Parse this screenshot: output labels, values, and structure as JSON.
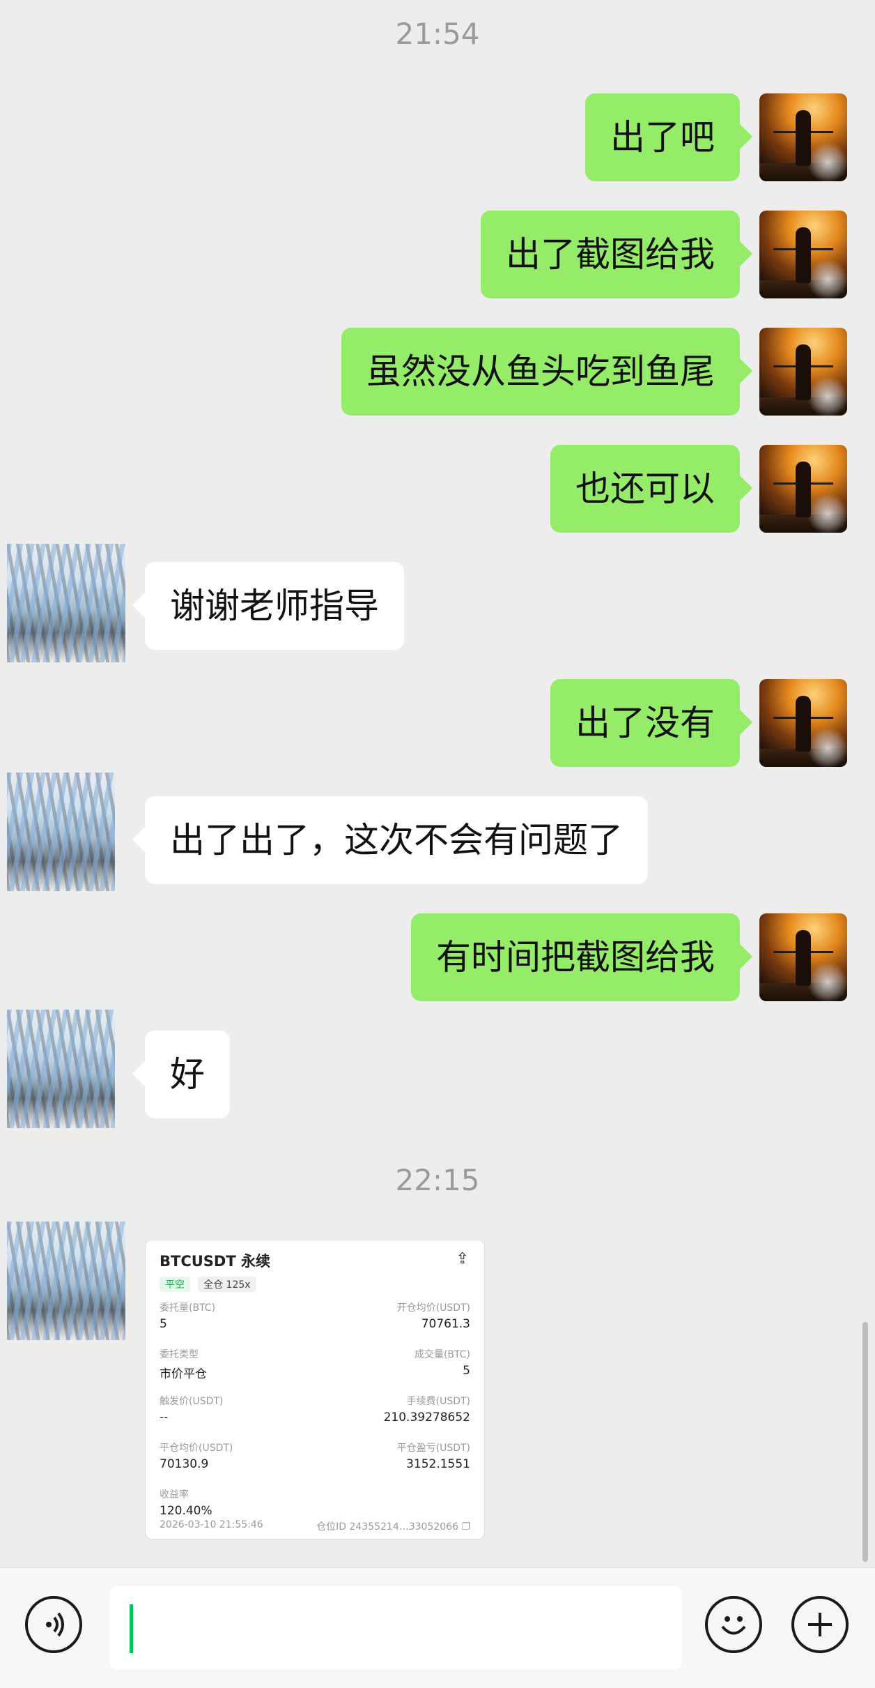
{
  "timestamps": [
    "21:54",
    "22:15"
  ],
  "messages": [
    {
      "from": "me",
      "text": "出了吧"
    },
    {
      "from": "me",
      "text": "出了截图给我"
    },
    {
      "from": "me",
      "text": "虽然没从鱼头吃到鱼尾"
    },
    {
      "from": "me",
      "text": "也还可以"
    },
    {
      "from": "other",
      "text": "谢谢老师指导"
    },
    {
      "from": "me",
      "text": "出了没有"
    },
    {
      "from": "other",
      "text": "出了出了，这次不会有问题了"
    },
    {
      "from": "me",
      "text": "有时间把截图给我"
    },
    {
      "from": "other",
      "text": "好"
    }
  ],
  "trade_card": {
    "title": "BTCUSDT 永续",
    "tag_side": "平空",
    "tag_margin": "全仓 125x",
    "order_qty_label": "委托量(BTC)",
    "order_qty": "5",
    "open_avg_label": "开仓均价(USDT)",
    "open_avg": "70761.3",
    "order_type_label": "委托类型",
    "order_type": "市价平仓",
    "filled_label": "成交量(BTC)",
    "filled": "5",
    "trigger_label": "触发价(USDT)",
    "trigger": "--",
    "fee_label": "手续费(USDT)",
    "fee": "210.39278652",
    "close_avg_label": "平仓均价(USDT)",
    "close_avg": "70130.9",
    "pnl_label": "平仓盈亏(USDT)",
    "pnl": "3152.1551",
    "roi_label": "收益率",
    "roi": "120.40%",
    "time": "2026-03-10 21:55:46",
    "position_id": "仓位ID 24355214…33052066"
  },
  "input": {
    "value": ""
  },
  "colors": {
    "my_bubble": "#95ec69",
    "other_bubble": "#ffffff",
    "background": "#ededed",
    "caret": "#07c160"
  }
}
